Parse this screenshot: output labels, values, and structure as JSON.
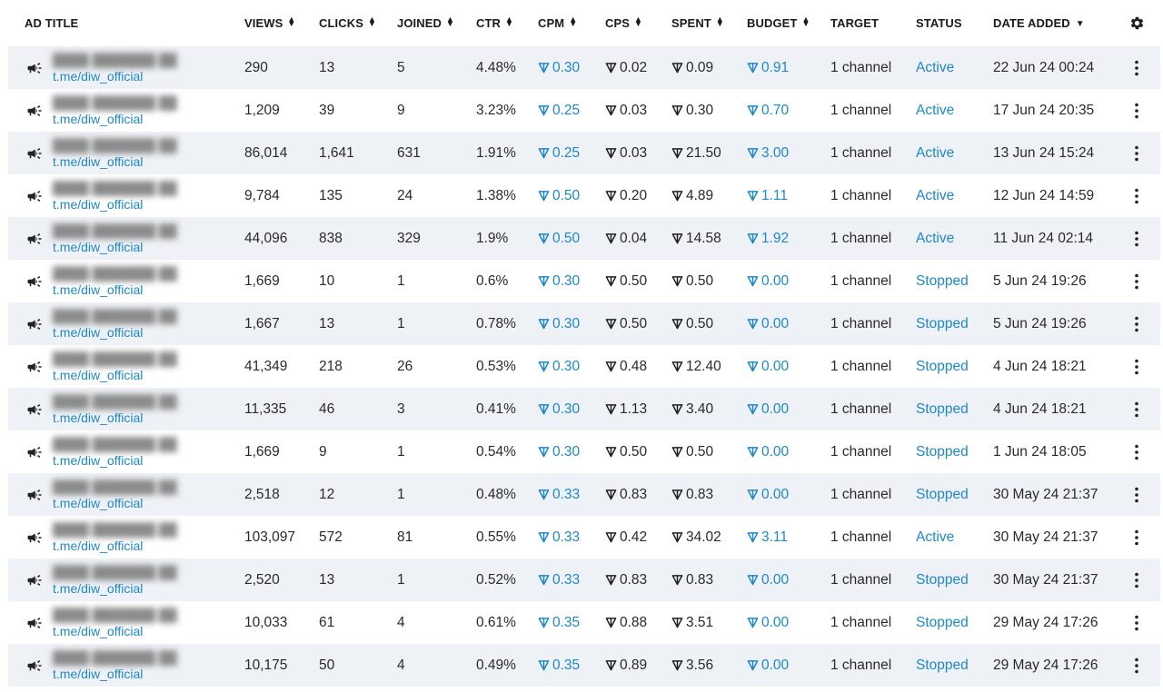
{
  "columns": {
    "ad_title": "AD TITLE",
    "views": "VIEWS",
    "clicks": "CLICKS",
    "joined": "JOINED",
    "ctr": "CTR",
    "cpm": "CPM",
    "cps": "CPS",
    "spent": "SPENT",
    "budget": "BUDGET",
    "target": "TARGET",
    "status": "STATUS",
    "date_added": "DATE ADDED"
  },
  "rows": [
    {
      "link": "t.me/diw_official",
      "views": "290",
      "clicks": "13",
      "joined": "5",
      "ctr": "4.48%",
      "cpm": "0.30",
      "cps": "0.02",
      "spent": "0.09",
      "budget": "0.91",
      "target": "1 channel",
      "status": "Active",
      "date": "22 Jun 24 00:24"
    },
    {
      "link": "t.me/diw_official",
      "views": "1,209",
      "clicks": "39",
      "joined": "9",
      "ctr": "3.23%",
      "cpm": "0.25",
      "cps": "0.03",
      "spent": "0.30",
      "budget": "0.70",
      "target": "1 channel",
      "status": "Active",
      "date": "17 Jun 24 20:35"
    },
    {
      "link": "t.me/diw_official",
      "views": "86,014",
      "clicks": "1,641",
      "joined": "631",
      "ctr": "1.91%",
      "cpm": "0.25",
      "cps": "0.03",
      "spent": "21.50",
      "budget": "3.00",
      "target": "1 channel",
      "status": "Active",
      "date": "13 Jun 24 15:24"
    },
    {
      "link": "t.me/diw_official",
      "views": "9,784",
      "clicks": "135",
      "joined": "24",
      "ctr": "1.38%",
      "cpm": "0.50",
      "cps": "0.20",
      "spent": "4.89",
      "budget": "1.11",
      "target": "1 channel",
      "status": "Active",
      "date": "12 Jun 24 14:59"
    },
    {
      "link": "t.me/diw_official",
      "views": "44,096",
      "clicks": "838",
      "joined": "329",
      "ctr": "1.9%",
      "cpm": "0.50",
      "cps": "0.04",
      "spent": "14.58",
      "budget": "1.92",
      "target": "1 channel",
      "status": "Active",
      "date": "11 Jun 24 02:14"
    },
    {
      "link": "t.me/diw_official",
      "views": "1,669",
      "clicks": "10",
      "joined": "1",
      "ctr": "0.6%",
      "cpm": "0.30",
      "cps": "0.50",
      "spent": "0.50",
      "budget": "0.00",
      "target": "1 channel",
      "status": "Stopped",
      "date": "5 Jun 24 19:26"
    },
    {
      "link": "t.me/diw_official",
      "views": "1,667",
      "clicks": "13",
      "joined": "1",
      "ctr": "0.78%",
      "cpm": "0.30",
      "cps": "0.50",
      "spent": "0.50",
      "budget": "0.00",
      "target": "1 channel",
      "status": "Stopped",
      "date": "5 Jun 24 19:26"
    },
    {
      "link": "t.me/diw_official",
      "views": "41,349",
      "clicks": "218",
      "joined": "26",
      "ctr": "0.53%",
      "cpm": "0.30",
      "cps": "0.48",
      "spent": "12.40",
      "budget": "0.00",
      "target": "1 channel",
      "status": "Stopped",
      "date": "4 Jun 24 18:21"
    },
    {
      "link": "t.me/diw_official",
      "views": "11,335",
      "clicks": "46",
      "joined": "3",
      "ctr": "0.41%",
      "cpm": "0.30",
      "cps": "1.13",
      "spent": "3.40",
      "budget": "0.00",
      "target": "1 channel",
      "status": "Stopped",
      "date": "4 Jun 24 18:21"
    },
    {
      "link": "t.me/diw_official",
      "views": "1,669",
      "clicks": "9",
      "joined": "1",
      "ctr": "0.54%",
      "cpm": "0.30",
      "cps": "0.50",
      "spent": "0.50",
      "budget": "0.00",
      "target": "1 channel",
      "status": "Stopped",
      "date": "1 Jun 24 18:05"
    },
    {
      "link": "t.me/diw_official",
      "views": "2,518",
      "clicks": "12",
      "joined": "1",
      "ctr": "0.48%",
      "cpm": "0.33",
      "cps": "0.83",
      "spent": "0.83",
      "budget": "0.00",
      "target": "1 channel",
      "status": "Stopped",
      "date": "30 May 24 21:37"
    },
    {
      "link": "t.me/diw_official",
      "views": "103,097",
      "clicks": "572",
      "joined": "81",
      "ctr": "0.55%",
      "cpm": "0.33",
      "cps": "0.42",
      "spent": "34.02",
      "budget": "3.11",
      "target": "1 channel",
      "status": "Active",
      "date": "30 May 24 21:37"
    },
    {
      "link": "t.me/diw_official",
      "views": "2,520",
      "clicks": "13",
      "joined": "1",
      "ctr": "0.52%",
      "cpm": "0.33",
      "cps": "0.83",
      "spent": "0.83",
      "budget": "0.00",
      "target": "1 channel",
      "status": "Stopped",
      "date": "30 May 24 21:37"
    },
    {
      "link": "t.me/diw_official",
      "views": "10,033",
      "clicks": "61",
      "joined": "4",
      "ctr": "0.61%",
      "cpm": "0.35",
      "cps": "0.88",
      "spent": "3.51",
      "budget": "0.00",
      "target": "1 channel",
      "status": "Stopped",
      "date": "29 May 24 17:26"
    },
    {
      "link": "t.me/diw_official",
      "views": "10,175",
      "clicks": "50",
      "joined": "4",
      "ctr": "0.49%",
      "cpm": "0.35",
      "cps": "0.89",
      "spent": "3.56",
      "budget": "0.00",
      "target": "1 channel",
      "status": "Stopped",
      "date": "29 May 24 17:26"
    }
  ],
  "icons": {
    "ad_row": "megaphone-icon",
    "currency": "ton-icon",
    "sort": "sort-icon",
    "sort_desc": "sort-desc-icon",
    "settings": "gear-icon",
    "row_menu": "more-vertical-icon"
  },
  "colors": {
    "link": "#1e88c8",
    "row_alt_bg": "#eef1f5",
    "text": "#2a2a2a"
  }
}
